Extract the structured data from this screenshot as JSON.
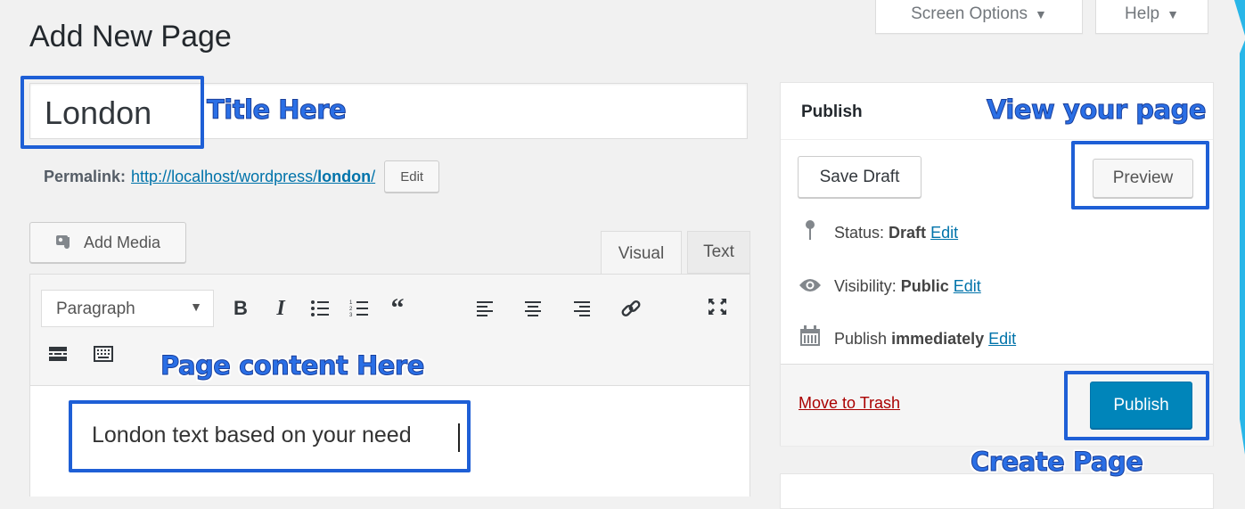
{
  "header": {
    "title": "Add New Page",
    "screen_options_label": "Screen Options",
    "help_label": "Help"
  },
  "post": {
    "title_value": "London",
    "permalink_label": "Permalink:",
    "permalink_url_prefix": "http://localhost/wordpress/",
    "permalink_slug": "london",
    "permalink_suffix": "/",
    "permalink_edit_label": "Edit"
  },
  "editor": {
    "add_media_label": "Add Media",
    "tab_visual": "Visual",
    "tab_text": "Text",
    "format_select_value": "Paragraph",
    "content_text": "London text based on your need",
    "toolbar_icons": [
      "bold-icon",
      "italic-icon",
      "bulleted-list-icon",
      "numbered-list-icon",
      "blockquote-icon",
      "align-left-icon",
      "align-center-icon",
      "align-right-icon",
      "link-icon",
      "fullscreen-icon",
      "read-more-icon",
      "toolbar-toggle-icon"
    ]
  },
  "publish": {
    "heading": "Publish",
    "save_draft_label": "Save Draft",
    "preview_label": "Preview",
    "status_label": "Status:",
    "status_value": "Draft",
    "visibility_label": "Visibility:",
    "visibility_value": "Public",
    "schedule_label": "Publish",
    "schedule_value": "immediately",
    "edit_label": "Edit",
    "trash_label": "Move to Trash",
    "publish_button_label": "Publish"
  },
  "annotations": {
    "title_here": "Title Here",
    "view_your_page": "View your page",
    "page_content_here": "Page content Here",
    "create_page": "Create Page"
  },
  "colors": {
    "accent_blue": "#0085ba",
    "link_blue": "#0073aa",
    "annotation_blue": "#1e5fd6",
    "trash_red": "#a00"
  }
}
